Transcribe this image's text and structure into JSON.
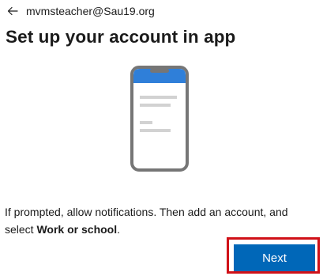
{
  "header": {
    "back_icon": "arrow-left-icon",
    "account_email": "mvmsteacher@Sau19.org"
  },
  "page": {
    "title": "Set up your account in app"
  },
  "illustration": {
    "icon": "phone-app-icon",
    "colors": {
      "frame": "#767676",
      "screen_header": "#2f7fd9",
      "lines": "#d2d2d2"
    }
  },
  "instructions": {
    "text_before": "If prompted, allow notifications. Then add an account, and select ",
    "emphasis": "Work or school",
    "text_after": "."
  },
  "actions": {
    "next_label": "Next",
    "next_color": "#0067b8",
    "highlight_color": "#d01118"
  }
}
